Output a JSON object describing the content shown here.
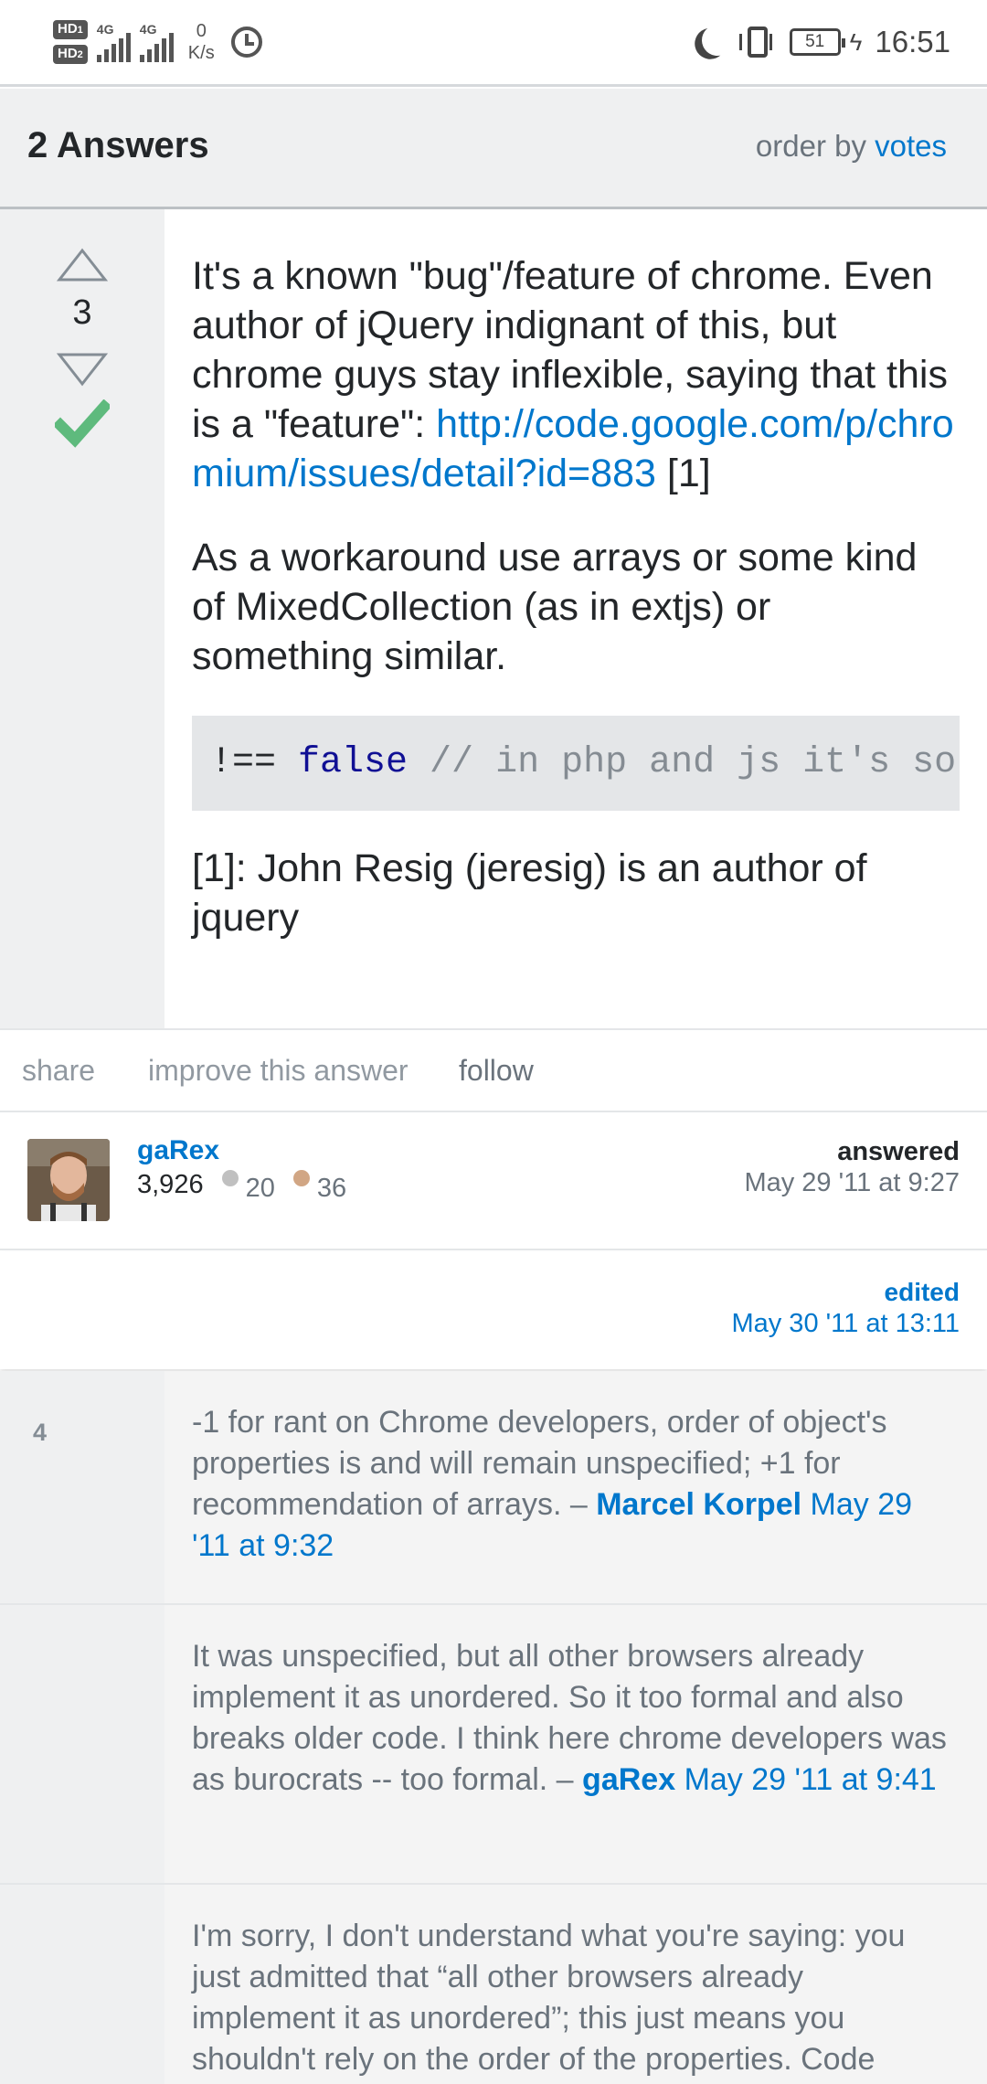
{
  "status_bar": {
    "hd1": "HD",
    "hd1_sub": "1",
    "hd2": "HD",
    "hd2_sub": "2",
    "net1": "4G",
    "net2": "4G",
    "speed_value": "0",
    "speed_unit": "K/s",
    "battery": "51",
    "time": "16:51"
  },
  "header": {
    "answers_count": "2 Answers",
    "order_prefix": "order by",
    "order_value": "votes"
  },
  "answer": {
    "score": "3",
    "accepted": true,
    "paragraph1_text": "It's a known \"bug\"/feature of chrome. Even author of jQuery indignant of this, but chrome guys stay inflexible, saying that this is a \"feature\": ",
    "link_text": "http://code.google.com/p/chromium/issues/detail?id=883",
    "link_suffix": " [1]",
    "paragraph2": "As a workaround use arrays or some kind of MixedCollection (as in extjs) or something similar.",
    "code_op": "!== ",
    "code_kw": "false",
    "code_comment": " // in php and js it's so",
    "paragraph3": "[1]: John Resig (jeresig) is an author of jquery"
  },
  "actions": {
    "share": "share",
    "improve": "improve this answer",
    "follow": "follow"
  },
  "user": {
    "name": "gaRex",
    "reputation": "3,926",
    "silver_badges": "20",
    "bronze_badges": "36",
    "answered_label": "answered",
    "answered_date": "May 29 '11 at 9:27"
  },
  "edited": {
    "label": "edited",
    "date": "May 30 '11 at 13:11"
  },
  "comments": [
    {
      "score": "4",
      "text": "-1 for rant on Chrome developers, order of object's properties is and will remain unspecified; +1 for recommendation of arrays. – ",
      "user": "Marcel Korpel",
      "date": "May 29 '11 at 9:32"
    },
    {
      "score": "",
      "text": "It was unspecified, but all other browsers already implement it as unordered. So it too formal and also breaks older code. I think here chrome developers was as burocrats -- too formal. – ",
      "user": "gaRex",
      "date": "May 29 '11 at 9:41"
    },
    {
      "score": "",
      "text": "I'm sorry, I don't understand what you're saying: you just admitted that “all other browsers already implement it as unordered”; this just means you shouldn't rely on the order of the properties. Code",
      "user": "",
      "date": ""
    }
  ],
  "colors": {
    "link": "#0077cc",
    "accepted_check": "#5eba7d",
    "silver_badge": "#c0c0c0",
    "bronze_badge": "#d1a684"
  }
}
